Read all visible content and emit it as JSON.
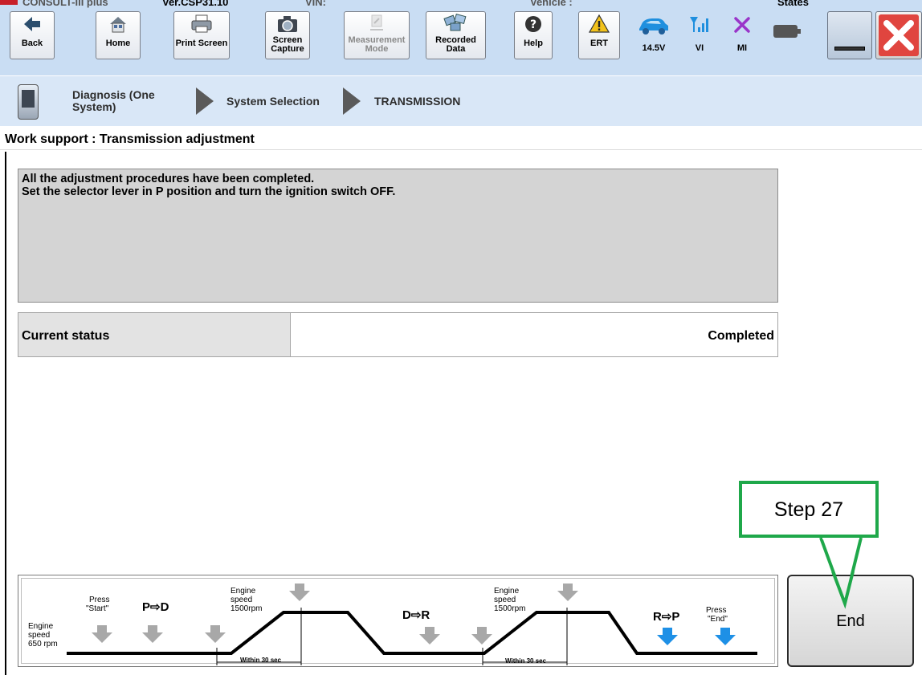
{
  "titlebar": {
    "app_name": "CONSULT-III plus",
    "version": "Ver.CSP31.10",
    "vin_label": "VIN:",
    "vehicle_label": "Vehicle :",
    "states_label": "States"
  },
  "toolbar": {
    "back": "Back",
    "home": "Home",
    "print_screen": "Print Screen",
    "screen_capture_1": "Screen",
    "screen_capture_2": "Capture",
    "measurement_1": "Measurement",
    "measurement_2": "Mode",
    "recorded_1": "Recorded",
    "recorded_2": "Data",
    "help": "Help",
    "ert": "ERT"
  },
  "status_icons": {
    "voltage": "14.5V",
    "vi": "VI",
    "mi": "MI"
  },
  "breadcrumb": {
    "item1_line1": "Diagnosis (One",
    "item1_line2": "System)",
    "item2": "System Selection",
    "item3": "TRANSMISSION"
  },
  "section_title": "Work support : Transmission adjustment",
  "message": {
    "line1": "All the adjustment procedures have been completed.",
    "line2": "Set the selector lever in P position and turn the ignition switch OFF."
  },
  "status": {
    "label": "Current status",
    "value": "Completed"
  },
  "callout": {
    "text": "Step 27",
    "color": "#1fa84a"
  },
  "end_button": {
    "label": "End"
  },
  "procedure": {
    "engine_speed_idle_1": "Engine",
    "engine_speed_idle_2": "speed",
    "engine_speed_idle_3": "650 rpm",
    "press_start_1": "Press",
    "press_start_2": "\"Start\"",
    "shift_pd": "P⇨D",
    "engine_speed_high_a_1": "Engine",
    "engine_speed_high_a_2": "speed",
    "engine_speed_high_a_3": "1500rpm",
    "within_a": "Within 30 sec",
    "shift_dr": "D⇨R",
    "engine_speed_high_b_1": "Engine",
    "engine_speed_high_b_2": "speed",
    "engine_speed_high_b_3": "1500rpm",
    "within_b": "Within 30 sec",
    "shift_rp": "R⇨P",
    "press_end_1": "Press",
    "press_end_2": "\"End\""
  },
  "colors": {
    "toolbar_bg": "#c9ddf3",
    "breadcrumb_bg": "#d9e7f7",
    "arrow_gray": "#a8a8a8",
    "arrow_blue": "#1e90e6",
    "close_red": "#e0453f"
  }
}
